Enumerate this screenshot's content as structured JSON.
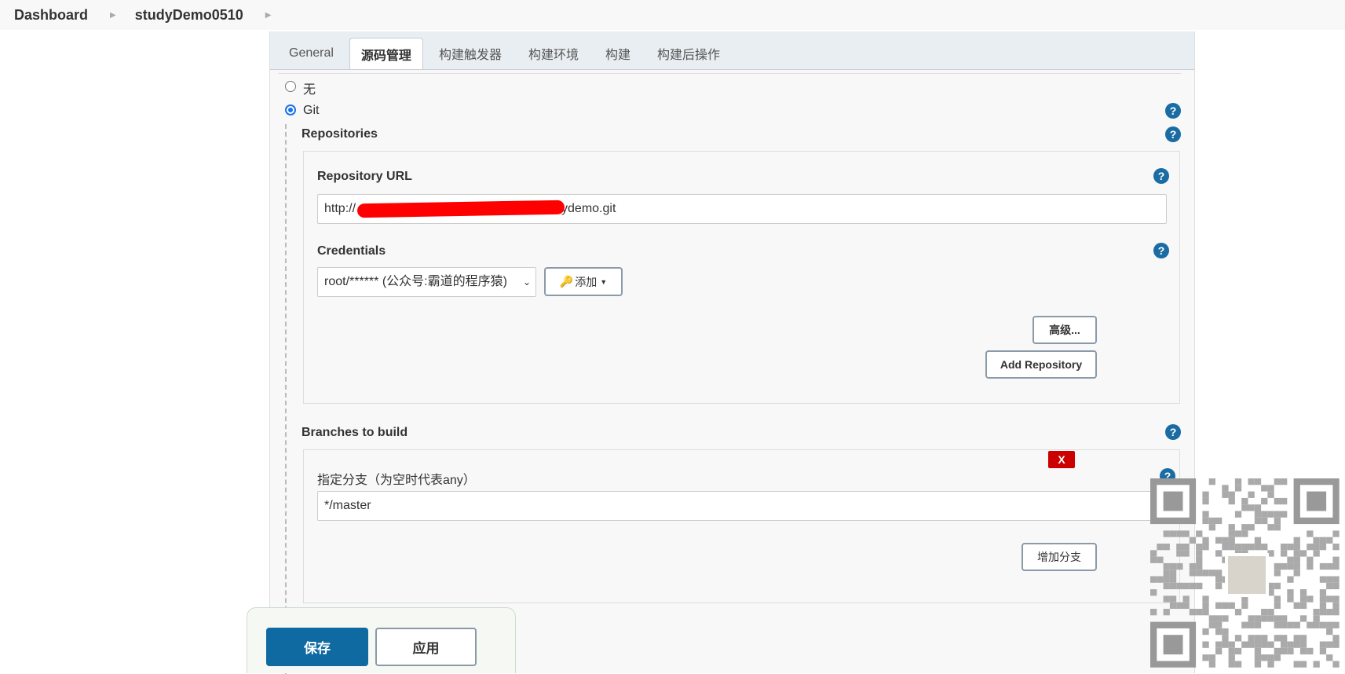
{
  "breadcrumb": [
    "Dashboard",
    "studyDemo0510"
  ],
  "tabs": [
    {
      "label": "General"
    },
    {
      "label": "源码管理",
      "active": true
    },
    {
      "label": "构建触发器"
    },
    {
      "label": "构建环境"
    },
    {
      "label": "构建"
    },
    {
      "label": "构建后操作"
    }
  ],
  "scm": {
    "option_none": "无",
    "option_git": "Git",
    "selected": "Git",
    "repositories_label": "Repositories",
    "repo_url_label": "Repository URL",
    "repo_url_prefix": "http://",
    "repo_url_suffix": "ydemo.git",
    "credentials_label": "Credentials",
    "credentials_value": "root/****** (公众号:霸道的程序猿)",
    "add_button": "添加",
    "advanced_button": "高级...",
    "add_repository_button": "Add Repository",
    "branches_label": "Branches to build",
    "branch_spec_label": "指定分支（为空时代表any）",
    "branch_spec_value": "*/master",
    "delete_button": "X",
    "add_branch_button": "增加分支"
  },
  "footer": {
    "save": "保存",
    "apply": "应用"
  },
  "colors": {
    "primary": "#1a6ca3",
    "danger": "#cc0000",
    "redaction": "#ff0000"
  }
}
